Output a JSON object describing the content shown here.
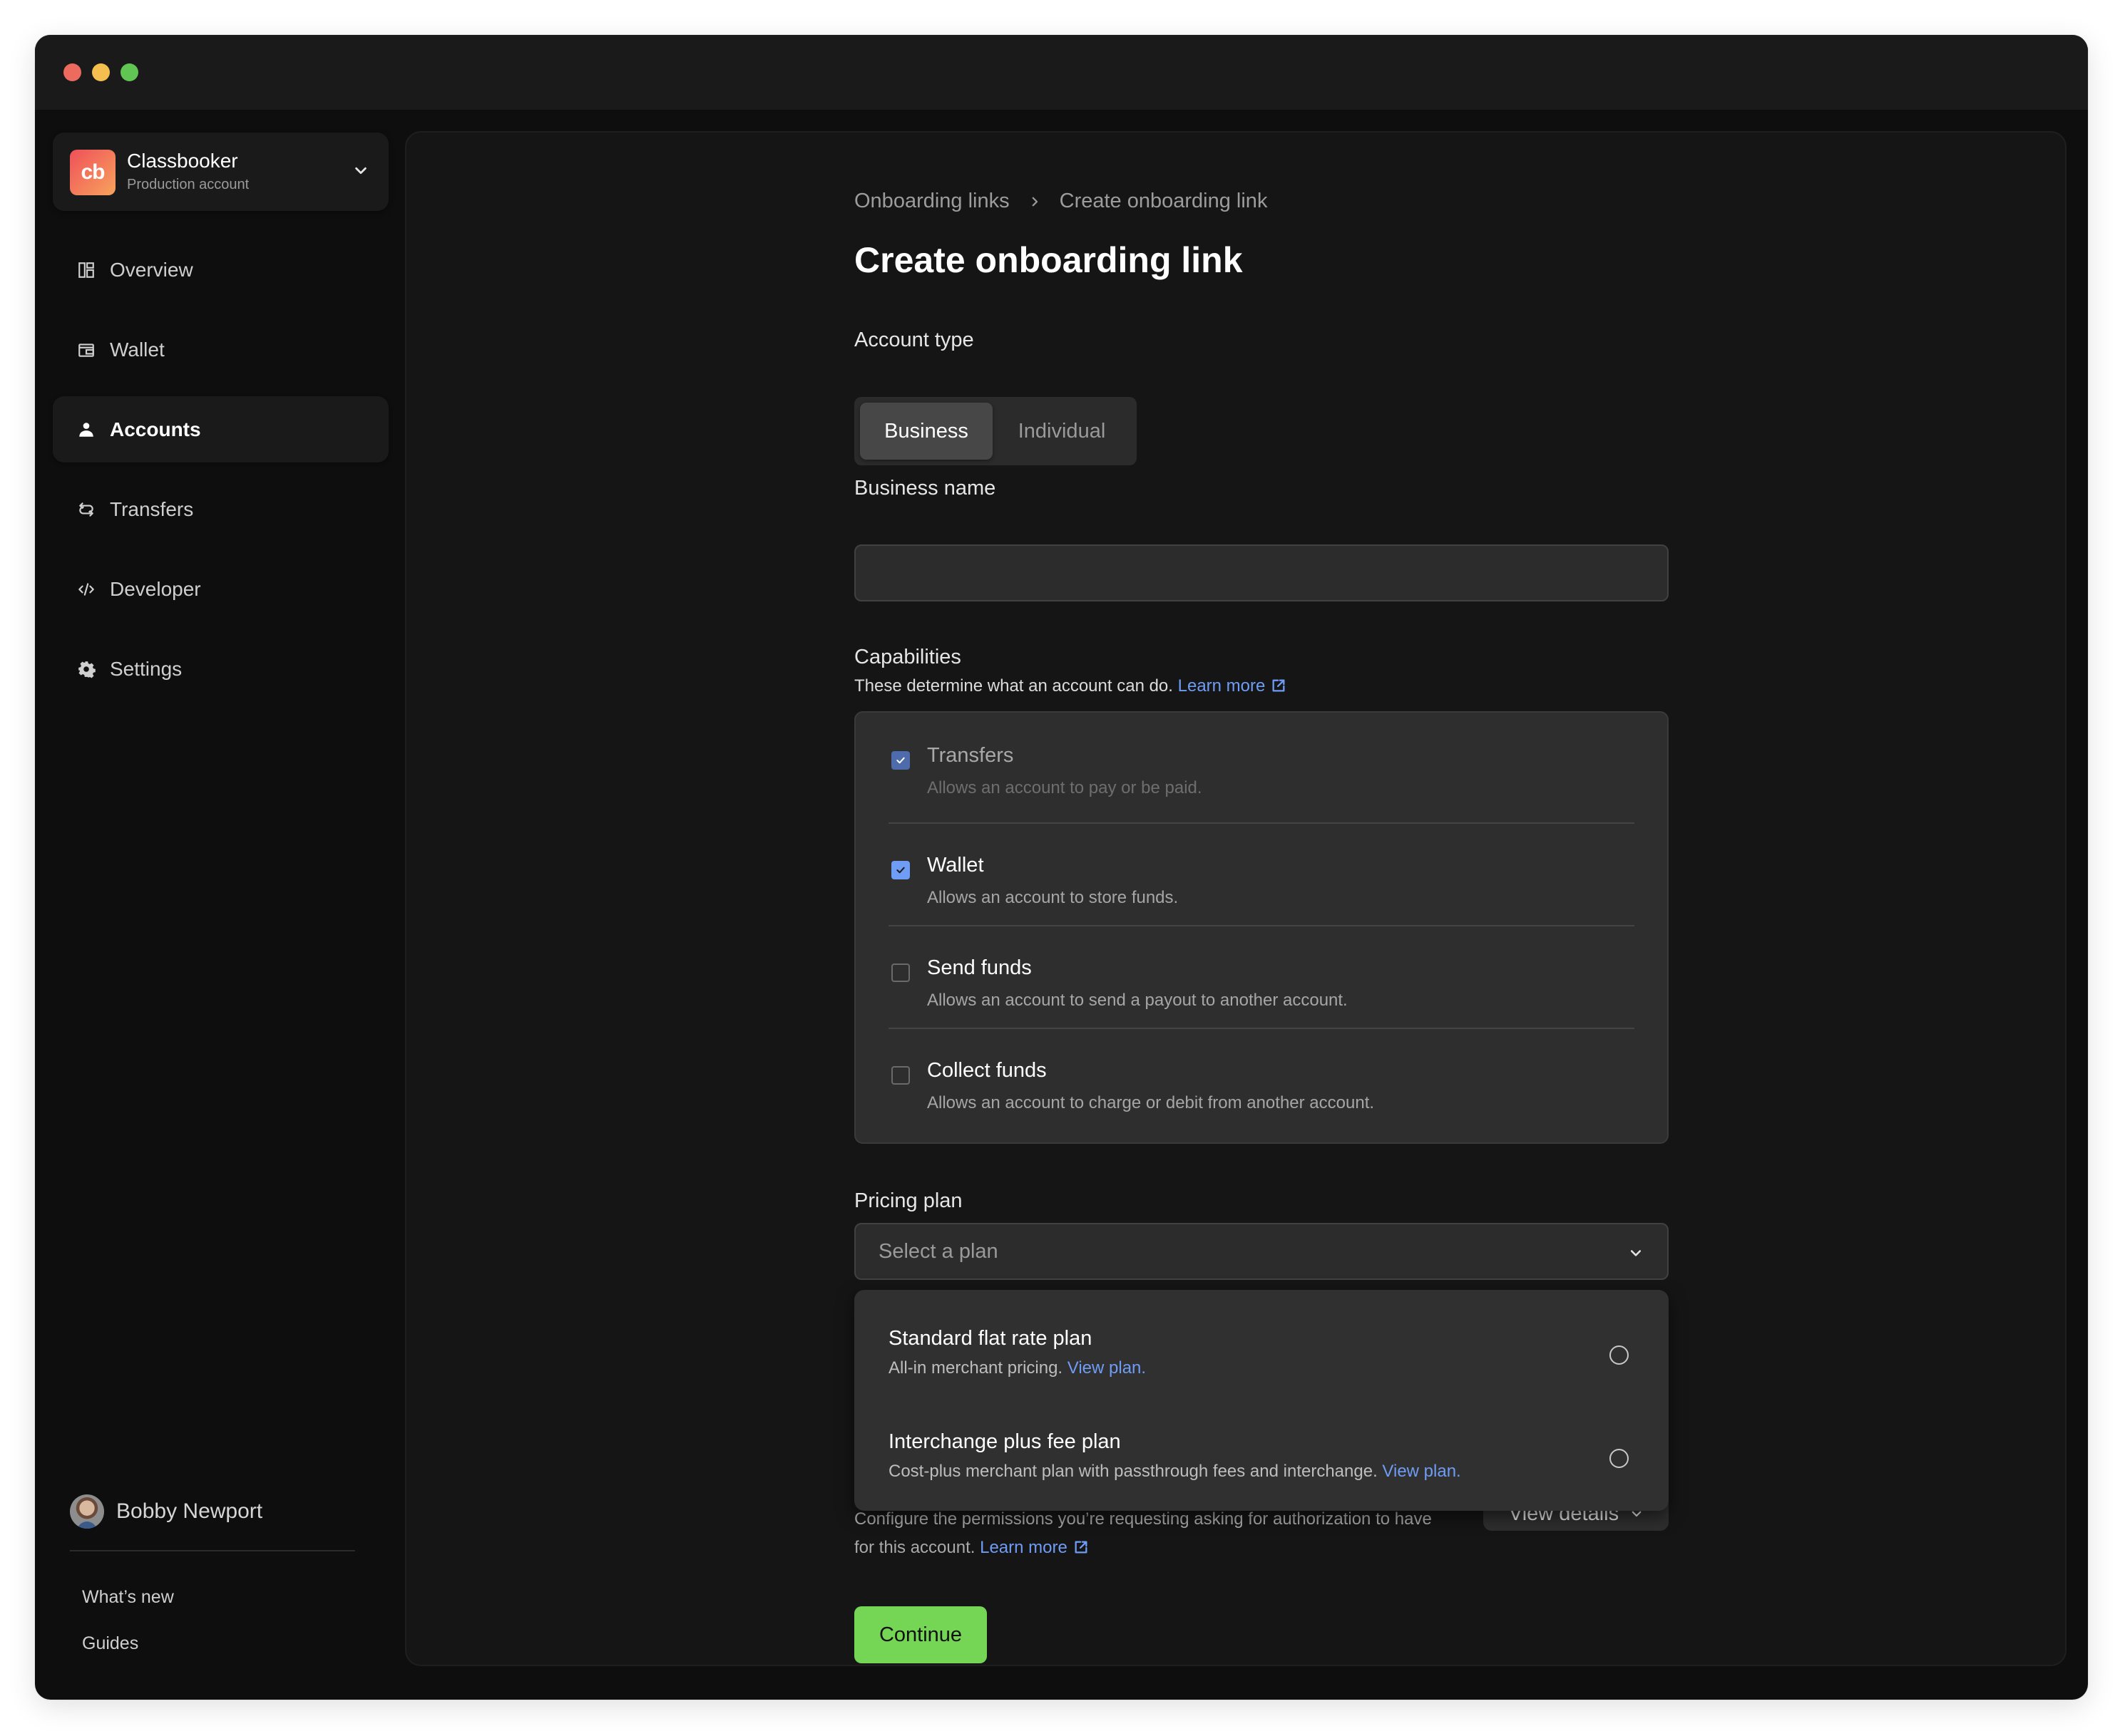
{
  "window": {
    "controls": [
      "close",
      "minimize",
      "zoom"
    ]
  },
  "sidebar": {
    "account": {
      "logo_text": "cb",
      "name": "Classbooker",
      "subtitle": "Production account"
    },
    "nav": [
      {
        "label": "Overview",
        "icon": "overview-icon",
        "active": false
      },
      {
        "label": "Wallet",
        "icon": "wallet-icon",
        "active": false
      },
      {
        "label": "Accounts",
        "icon": "user-icon",
        "active": true
      },
      {
        "label": "Transfers",
        "icon": "transfers-icon",
        "active": false
      },
      {
        "label": "Developer",
        "icon": "code-icon",
        "active": false
      },
      {
        "label": "Settings",
        "icon": "gear-icon",
        "active": false
      }
    ],
    "user": {
      "name": "Bobby Newport"
    },
    "footer_links": [
      "What’s new",
      "Guides"
    ]
  },
  "main": {
    "breadcrumb": [
      "Onboarding links",
      "Create onboarding link"
    ],
    "title": "Create onboarding link",
    "account_type": {
      "label": "Account type",
      "options": [
        "Business",
        "Individual"
      ],
      "selected": "Business"
    },
    "business_name": {
      "label": "Business name",
      "value": "",
      "placeholder": ""
    },
    "capabilities": {
      "label": "Capabilities",
      "helper": "These determine what an account can do.",
      "learn_more": "Learn more",
      "items": [
        {
          "title": "Transfers",
          "description": "Allows an account to pay or be paid.",
          "checked": true,
          "disabled": true
        },
        {
          "title": "Wallet",
          "description": "Allows an account to store funds.",
          "checked": true,
          "disabled": false
        },
        {
          "title": "Send funds",
          "description": "Allows an account to send a payout to another account.",
          "checked": false,
          "disabled": false
        },
        {
          "title": "Collect funds",
          "description": "Allows an account to charge or debit from another account.",
          "checked": false,
          "disabled": false
        }
      ]
    },
    "pricing_plan": {
      "label": "Pricing plan",
      "placeholder": "Select a plan",
      "options": [
        {
          "title": "Standard flat rate plan",
          "description": "All-in merchant pricing.",
          "link": "View plan.",
          "selected": false
        },
        {
          "title": "Interchange plus fee plan",
          "description": "Cost-plus merchant plan with passthrough fees and interchange.",
          "link": "View plan.",
          "selected": false
        }
      ]
    },
    "permissions": {
      "text": "Configure the permissions you’re requesting asking for authorization to have for this account.",
      "learn_more": "Learn more",
      "view_details": "View details"
    },
    "continue_label": "Continue"
  },
  "colors": {
    "accent_link": "#6f9cf4",
    "primary_button": "#75d656",
    "checkbox_checked": "#6f9cf4"
  }
}
